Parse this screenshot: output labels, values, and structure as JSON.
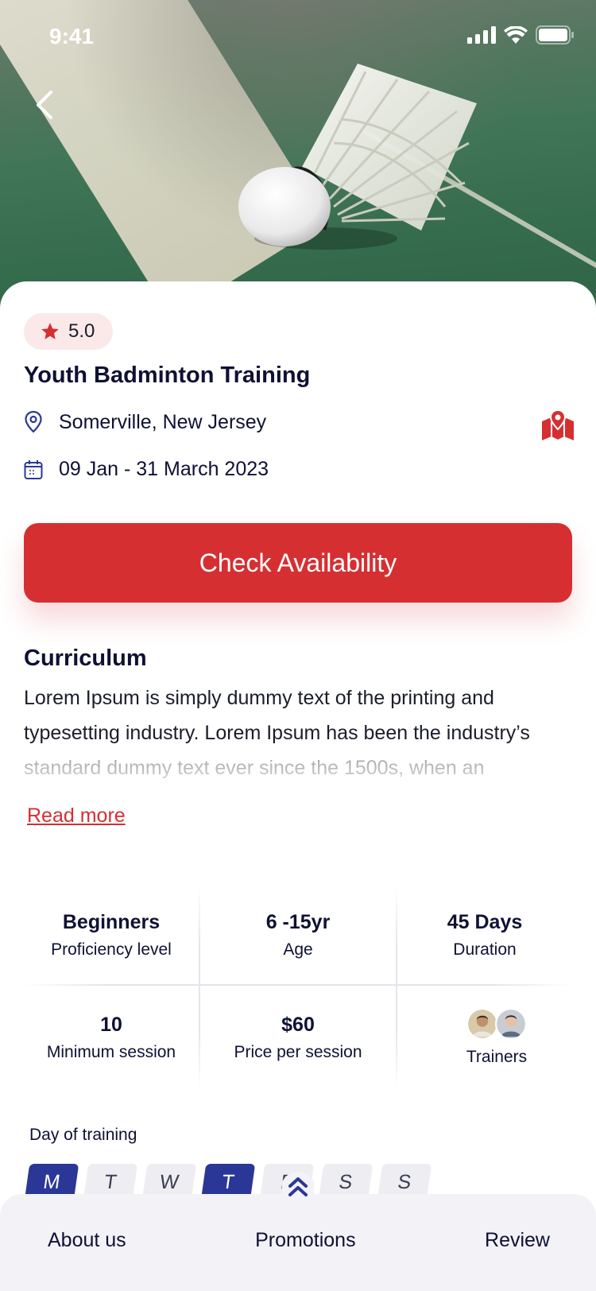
{
  "status_bar": {
    "time": "9:41"
  },
  "header": {
    "back_icon": "chevron-left-icon"
  },
  "course": {
    "rating": "5.0",
    "title": "Youth Badminton Training",
    "location": "Somerville, New Jersey",
    "dates": "09 Jan - 31 March 2023"
  },
  "cta": {
    "label": "Check Availability"
  },
  "curriculum": {
    "title": "Curriculum",
    "text": "Lorem Ipsum is simply dummy text of the printing and typesetting industry. Lorem Ipsum has been the industry’s standard dummy text ever since the 1500s, when an",
    "read_more": "Read more"
  },
  "stats": [
    {
      "value": "Beginners",
      "label": "Proficiency level"
    },
    {
      "value": "6 -15yr",
      "label": "Age"
    },
    {
      "value": "45 Days",
      "label": "Duration"
    },
    {
      "value": "10",
      "label": "Minimum session"
    },
    {
      "value": "$60",
      "label": "Price per session"
    },
    {
      "value": "",
      "label": "Trainers"
    }
  ],
  "training_days": {
    "label": "Day of training",
    "days": [
      {
        "label": "M",
        "active": true
      },
      {
        "label": "T",
        "active": false
      },
      {
        "label": "W",
        "active": false
      },
      {
        "label": "T",
        "active": true
      },
      {
        "label": "F",
        "active": false
      },
      {
        "label": "S",
        "active": false
      },
      {
        "label": "S",
        "active": false
      }
    ]
  },
  "bottom_tabs": [
    "About us",
    "Promotions",
    "Review"
  ],
  "colors": {
    "accent": "#d62f32",
    "primary": "#2b3797",
    "text": "#0e1133"
  }
}
